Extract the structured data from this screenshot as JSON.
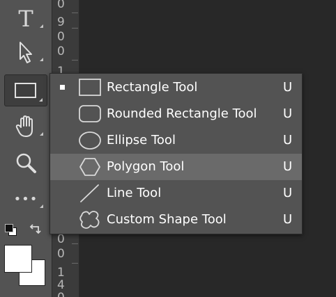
{
  "toolbar": {
    "tools": [
      {
        "name": "type-tool",
        "icon": "type-icon",
        "label": "T"
      },
      {
        "name": "path-selection-tool",
        "icon": "arrow-icon"
      },
      {
        "name": "rectangle-tool",
        "icon": "rectangle-icon",
        "active": true
      },
      {
        "name": "hand-tool",
        "icon": "hand-icon"
      },
      {
        "name": "zoom-tool",
        "icon": "magnifier-icon"
      },
      {
        "name": "edit-toolbar",
        "icon": "ellipsis-icon",
        "label": "•••"
      }
    ],
    "colors": {
      "foreground": "#ffffff",
      "background": "#ffffff"
    }
  },
  "ruler": {
    "numbers_top": [
      "0",
      "9",
      "0",
      "0",
      "1"
    ],
    "numbers_bottom": [
      "0",
      "0",
      "1",
      "4",
      "0"
    ]
  },
  "shape_menu": {
    "items": [
      {
        "label": "Rectangle Tool",
        "shortcut": "U",
        "icon": "rectangle-icon",
        "selected": true
      },
      {
        "label": "Rounded Rectangle Tool",
        "shortcut": "U",
        "icon": "rounded-rectangle-icon"
      },
      {
        "label": "Ellipse Tool",
        "shortcut": "U",
        "icon": "ellipse-icon"
      },
      {
        "label": "Polygon Tool",
        "shortcut": "U",
        "icon": "polygon-icon",
        "highlighted": true
      },
      {
        "label": "Line Tool",
        "shortcut": "U",
        "icon": "line-icon"
      },
      {
        "label": "Custom Shape Tool",
        "shortcut": "U",
        "icon": "custom-shape-icon"
      }
    ]
  }
}
